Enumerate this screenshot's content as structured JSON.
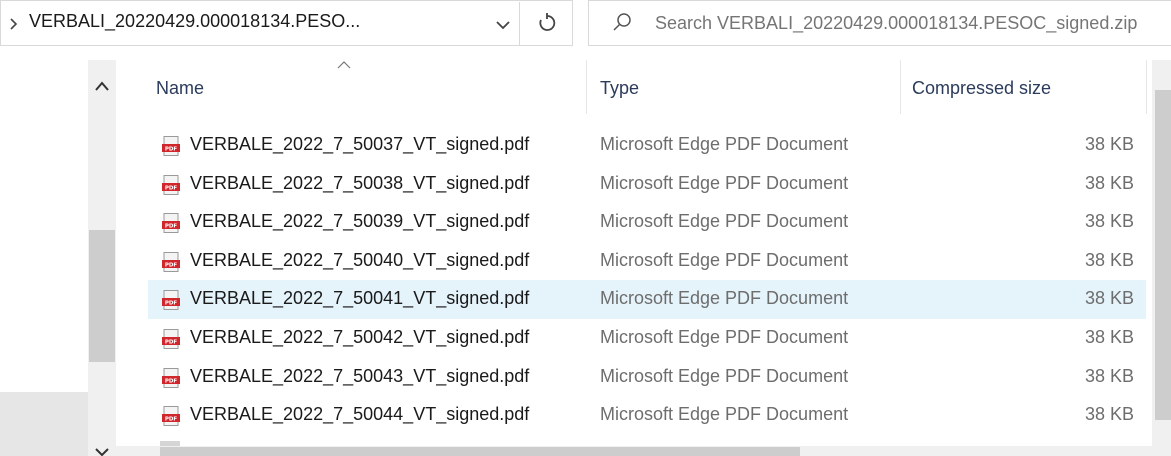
{
  "address_bar": {
    "path": "VERBALI_20220429.000018134.PESO..."
  },
  "search": {
    "placeholder": "Search VERBALI_20220429.000018134.PESOC_signed.zip"
  },
  "columns": {
    "name": "Name",
    "type": "Type",
    "compressed_size": "Compressed size"
  },
  "files": [
    {
      "name": "VERBALE_2022_7_50037_VT_signed.pdf",
      "type": "Microsoft Edge PDF Document",
      "size": "38 KB"
    },
    {
      "name": "VERBALE_2022_7_50038_VT_signed.pdf",
      "type": "Microsoft Edge PDF Document",
      "size": "38 KB"
    },
    {
      "name": "VERBALE_2022_7_50039_VT_signed.pdf",
      "type": "Microsoft Edge PDF Document",
      "size": "38 KB"
    },
    {
      "name": "VERBALE_2022_7_50040_VT_signed.pdf",
      "type": "Microsoft Edge PDF Document",
      "size": "38 KB"
    },
    {
      "name": "VERBALE_2022_7_50041_VT_signed.pdf",
      "type": "Microsoft Edge PDF Document",
      "size": "38 KB",
      "selected": true
    },
    {
      "name": "VERBALE_2022_7_50042_VT_signed.pdf",
      "type": "Microsoft Edge PDF Document",
      "size": "38 KB"
    },
    {
      "name": "VERBALE_2022_7_50043_VT_signed.pdf",
      "type": "Microsoft Edge PDF Document",
      "size": "38 KB"
    },
    {
      "name": "VERBALE_2022_7_50044_VT_signed.pdf",
      "type": "Microsoft Edge PDF Document",
      "size": "38 KB"
    }
  ],
  "icons": {
    "file": "pdf-file-icon",
    "refresh": "refresh-icon",
    "search": "search-icon",
    "dropdown": "chevron-down-icon",
    "breadcrumb": "chevron-right-icon"
  },
  "colors": {
    "selected_row": "#e5f3fb",
    "header_text": "#2b3b5c",
    "secondary_text": "#6d6d6d",
    "pdf_red": "#d0272d"
  }
}
